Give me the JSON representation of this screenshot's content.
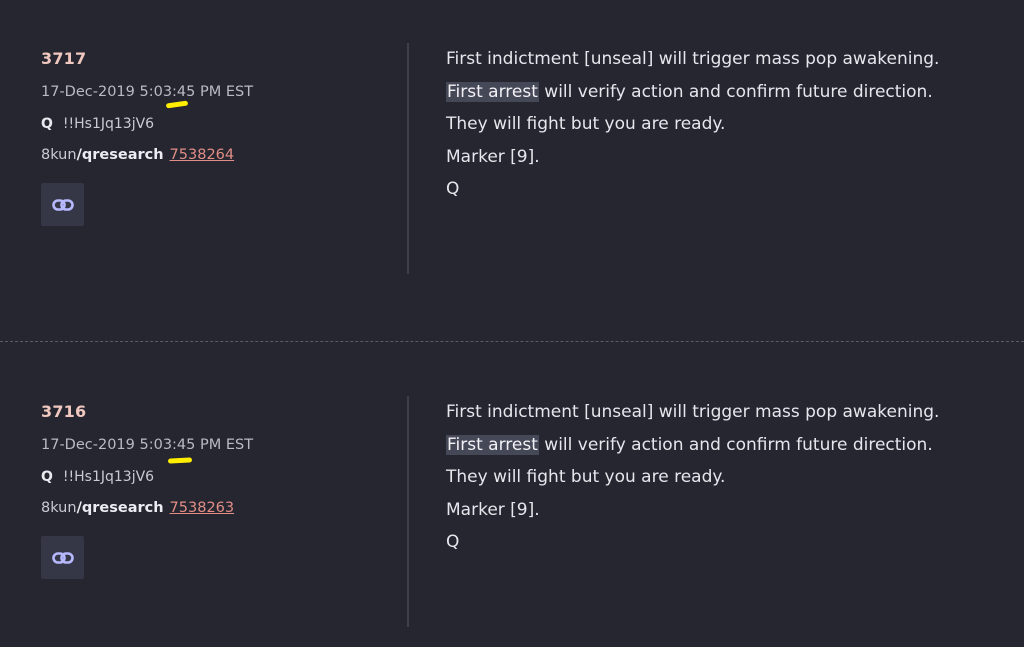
{
  "posts": [
    {
      "number": "3717",
      "timestamp": "17-Dec-2019 5:03:45 PM EST",
      "author_name": "Q",
      "tripcode": "!!Hs1Jq13jV6",
      "site": "8kun",
      "board": "/qresearch",
      "post_id": "7538264",
      "link_icon": "chain-link-icon",
      "lines": {
        "l1": "First indictment [unseal] will trigger mass pop awakening.",
        "l2_highlight": "First arrest",
        "l2_rest": " will verify action and confirm future direction.",
        "l3": "They will fight but you are ready.",
        "l4": "Marker [9].",
        "l5": "Q"
      }
    },
    {
      "number": "3716",
      "timestamp": "17-Dec-2019 5:03:45 PM EST",
      "author_name": "Q",
      "tripcode": "!!Hs1Jq13jV6",
      "site": "8kun",
      "board": "/qresearch",
      "post_id": "7538263",
      "link_icon": "chain-link-icon",
      "lines": {
        "l1": "First indictment [unseal] will trigger mass pop awakening.",
        "l2_highlight": "First arrest",
        "l2_rest": " will verify action and confirm future direction.",
        "l3": "They will fight but you are ready.",
        "l4": "Marker [9].",
        "l5": "Q"
      }
    }
  ],
  "colors": {
    "background": "#25262f",
    "post_number": "#f0c8c0",
    "link": "#e28d86",
    "highlight_bg": "#454857",
    "annotation": "#ffee00"
  }
}
